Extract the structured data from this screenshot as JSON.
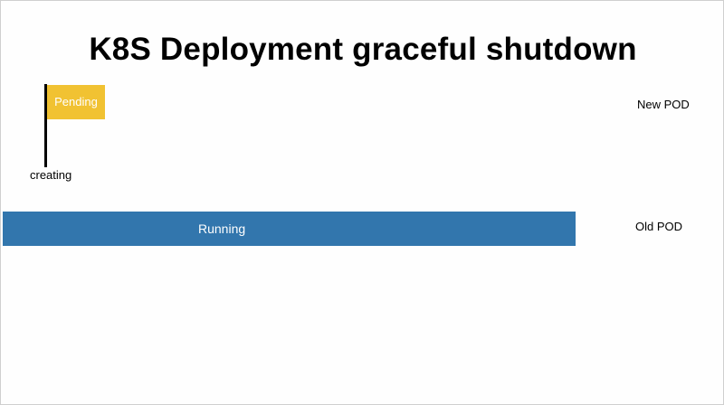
{
  "title": "K8S Deployment graceful shutdown",
  "new_pod": {
    "state_label": "Pending",
    "phase_label": "creating",
    "row_label": "New POD",
    "color": "#f1c232"
  },
  "old_pod": {
    "state_label": "Running",
    "row_label": "Old POD",
    "color": "#3276ad"
  }
}
